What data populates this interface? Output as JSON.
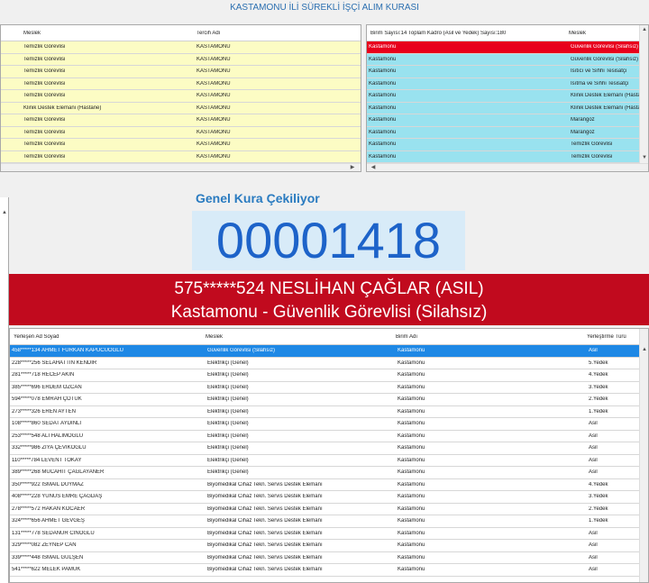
{
  "title": "KASTAMONU İLİ SÜREKLİ İŞÇİ ALIM KURASI",
  "left_table": {
    "headers": [
      "Meslek",
      "Tercih Adı"
    ],
    "rows": [
      [
        "Temizlik Görevlisi",
        "KASTAMONU"
      ],
      [
        "Temizlik Görevlisi",
        "KASTAMONU"
      ],
      [
        "Temizlik Görevlisi",
        "KASTAMONU"
      ],
      [
        "Temizlik Görevlisi",
        "KASTAMONU"
      ],
      [
        "Temizlik Görevlisi",
        "KASTAMONU"
      ],
      [
        "Klinik Destek Elemanı (Hastane)",
        "KASTAMONU"
      ],
      [
        "Temizlik Görevlisi",
        "KASTAMONU"
      ],
      [
        "Temizlik Görevlisi",
        "KASTAMONU"
      ],
      [
        "Temizlik Görevlisi",
        "KASTAMONU"
      ],
      [
        "Temizlik Görevlisi",
        "KASTAMONU"
      ]
    ]
  },
  "right_table": {
    "headers": [
      "Birim Sayısı:14 Toplam Kadro (Asil ve Yedek) Sayısı:180",
      "Meslek"
    ],
    "rows": [
      [
        "Kastamonu",
        "Güvenlik Görevlisi (Silahsız)"
      ],
      [
        "Kastamonu",
        "Güvenlik Görevlisi (Silahsız)"
      ],
      [
        "Kastamonu",
        "Isıtıcı ve Sıhhi Tesisatçı"
      ],
      [
        "Kastamonu",
        "Isıtma ve Sıhhi Tesisatçı"
      ],
      [
        "Kastamonu",
        "Klinik Destek Elemanı (Hastane)"
      ],
      [
        "Kastamonu",
        "Klinik Destek Elemanı (Hastane)"
      ],
      [
        "Kastamonu",
        "Marangoz"
      ],
      [
        "Kastamonu",
        "Marangoz"
      ],
      [
        "Kastamonu",
        "Temizlik Görevlisi"
      ],
      [
        "Kastamonu",
        "Temizlik Görevlisi"
      ]
    ]
  },
  "draw": {
    "label": "Genel Kura Çekiliyor",
    "number": "00001418",
    "winner_line1": "575*****524 NESLİHAN ÇAĞLAR (ASIL)",
    "winner_line2": "Kastamonu - Güvenlik Görevlisi (Silahsız)"
  },
  "results_table": {
    "headers": [
      "Yerleşen Ad Soyad",
      "Meslek",
      "Birim Adı",
      "Yerleştirme Türü"
    ],
    "rows": [
      [
        "458*****134 AHMET FURKAN KAPUCUOĞLU",
        "Güvenlik Görevlisi (Silahsız)",
        "Kastamonu",
        "Asil"
      ],
      [
        "228*****256 SELAHATTİN KENDİR",
        "Elektrikçi (Genel)",
        "Kastamonu",
        "5.Yedek"
      ],
      [
        "281*****718 RECEP AKIN",
        "Elektrikçi (Genel)",
        "Kastamonu",
        "4.Yedek"
      ],
      [
        "385*****696 ERDEM ÖZCAN",
        "Elektrikçi (Genel)",
        "Kastamonu",
        "3.Yedek"
      ],
      [
        "594*****078 EMRAH ÇOTUK",
        "Elektrikçi (Genel)",
        "Kastamonu",
        "2.Yedek"
      ],
      [
        "273*****326 EREN AYTEN",
        "Elektrikçi (Genel)",
        "Kastamonu",
        "1.Yedek"
      ],
      [
        "108*****860 SEDAT AYDINLI",
        "Elektrikçi (Genel)",
        "Kastamonu",
        "Asil"
      ],
      [
        "253*****548 ALİ HALİMOĞLU",
        "Elektrikçi (Genel)",
        "Kastamonu",
        "Asil"
      ],
      [
        "332*****986 ZİYA ÇEVİKOĞLU",
        "Elektrikçi (Genel)",
        "Kastamonu",
        "Asil"
      ],
      [
        "110*****784 LEVENT TOKAY",
        "Elektrikçi (Genel)",
        "Kastamonu",
        "Asil"
      ],
      [
        "389*****268 MÜCAHİT ÇAĞLAYANER",
        "Elektrikçi (Genel)",
        "Kastamonu",
        "Asil"
      ],
      [
        "350*****922 İSMAİL DUYMAZ",
        "Biyomedikal Cihaz Tekn. Servis Destek Elemanı",
        "Kastamonu",
        "4.Yedek"
      ],
      [
        "408*****228 YUNUS EMRE ÇAĞDAŞ",
        "Biyomedikal Cihaz Tekn. Servis Destek Elemanı",
        "Kastamonu",
        "3.Yedek"
      ],
      [
        "278*****572 HAKAN KOCAER",
        "Biyomedikal Cihaz Tekn. Servis Destek Elemanı",
        "Kastamonu",
        "2.Yedek"
      ],
      [
        "324*****656 AHMET GEVGEŞ",
        "Biyomedikal Cihaz Tekn. Servis Destek Elemanı",
        "Kastamonu",
        "1.Yedek"
      ],
      [
        "131*****778 SEDANUR CINOĞLU",
        "Biyomedikal Cihaz Tekn. Servis Destek Elemanı",
        "Kastamonu",
        "Asil"
      ],
      [
        "329*****082 ZEYNEP CAN",
        "Biyomedikal Cihaz Tekn. Servis Destek Elemanı",
        "Kastamonu",
        "Asil"
      ],
      [
        "339*****448 İSMAİL GÜLŞEN",
        "Biyomedikal Cihaz Tekn. Servis Destek Elemanı",
        "Kastamonu",
        "Asil"
      ],
      [
        "541*****622 MELEK PAMUK",
        "Biyomedikal Cihaz Tekn. Servis Destek Elemanı",
        "Kastamonu",
        "Asil"
      ]
    ]
  },
  "icons": {
    "scroll_up": "up-arrow-icon",
    "scroll_down": "down-arrow-icon",
    "scroll_left": "left-arrow-icon",
    "scroll_right": "right-arrow-icon"
  }
}
